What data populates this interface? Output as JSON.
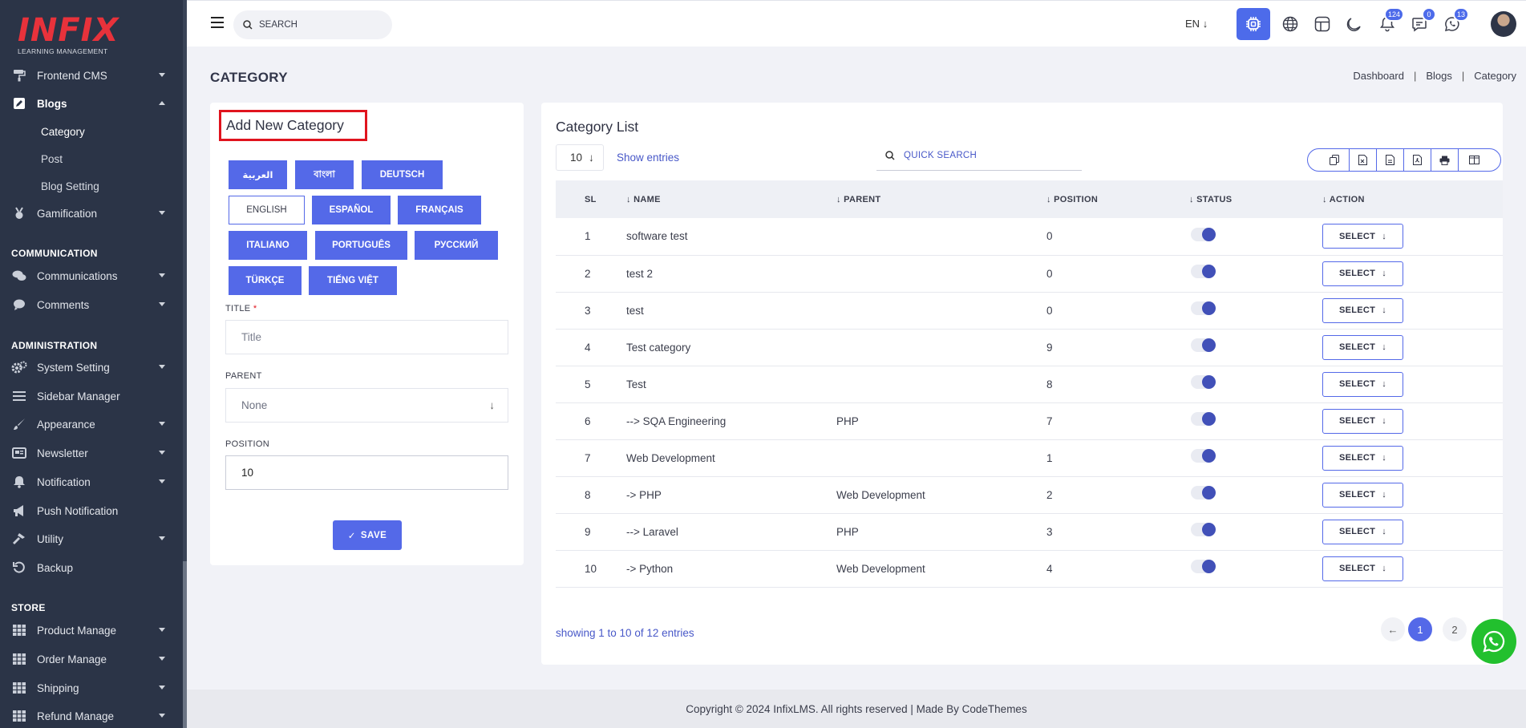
{
  "brand": {
    "name": "INFIX",
    "tagline": "LEARNING MANAGEMENT",
    "accent": "#e8323b",
    "primary": "#5469e8"
  },
  "sidebar": {
    "items": [
      {
        "label": "Frontend CMS",
        "icon": "paint-roller-icon"
      },
      {
        "label": "Blogs",
        "icon": "edit-icon"
      },
      {
        "label": "Gamification",
        "icon": "medal-icon"
      },
      {
        "label": "Communications",
        "icon": "chat-bubbles-icon"
      },
      {
        "label": "Comments",
        "icon": "comment-icon"
      },
      {
        "label": "System Setting",
        "icon": "gears-icon"
      },
      {
        "label": "Sidebar Manager",
        "icon": "bars-icon"
      },
      {
        "label": "Appearance",
        "icon": "brush-icon"
      },
      {
        "label": "Newsletter",
        "icon": "newsletter-icon"
      },
      {
        "label": "Notification",
        "icon": "bell-icon"
      },
      {
        "label": "Push Notification",
        "icon": "megaphone-icon"
      },
      {
        "label": "Utility",
        "icon": "hammer-icon"
      },
      {
        "label": "Backup",
        "icon": "backup-icon"
      },
      {
        "label": "Product Manage",
        "icon": "grid-icon"
      },
      {
        "label": "Order Manage",
        "icon": "grid-icon"
      },
      {
        "label": "Shipping",
        "icon": "grid-icon"
      },
      {
        "label": "Refund Manage",
        "icon": "grid-icon"
      }
    ],
    "blog_sub": [
      "Category",
      "Post",
      "Blog Setting"
    ],
    "sections": {
      "communication": "COMMUNICATION",
      "administration": "ADMINISTRATION",
      "store": "STORE"
    }
  },
  "topbar": {
    "search_placeholder": "SEARCH",
    "language": "EN",
    "badges": {
      "notifications": "124",
      "messages": "0",
      "whatsapp": "13"
    }
  },
  "page": {
    "title": "CATEGORY",
    "breadcrumb": [
      "Dashboard",
      "Blogs",
      "Category"
    ]
  },
  "form": {
    "title": "Add New Category",
    "languages": [
      "العربية",
      "বাংলা",
      "DEUTSCH",
      "ENGLISH",
      "ESPAÑOL",
      "FRANÇAIS",
      "ITALIANO",
      "PORTUGUÊS",
      "РУССКИЙ",
      "TÜRKÇE",
      "TIẾNG VIỆT"
    ],
    "active_language": "ENGLISH",
    "title_label": "TITLE",
    "title_required": "*",
    "title_placeholder": "Title",
    "parent_label": "PARENT",
    "parent_value": "None",
    "position_label": "POSITION",
    "position_value": "10",
    "save_label": "SAVE"
  },
  "list": {
    "title": "Category List",
    "entries_value": "10",
    "show_entries": "Show entries",
    "search_placeholder": "QUICK SEARCH",
    "columns": [
      "SL",
      "NAME",
      "PARENT",
      "POSITION",
      "STATUS",
      "ACTION"
    ],
    "rows": [
      {
        "sl": "1",
        "name": "software test",
        "parent": "",
        "position": "0",
        "status": true
      },
      {
        "sl": "2",
        "name": "test 2",
        "parent": "",
        "position": "0",
        "status": true
      },
      {
        "sl": "3",
        "name": "test",
        "parent": "",
        "position": "0",
        "status": true
      },
      {
        "sl": "4",
        "name": "Test category",
        "parent": "",
        "position": "9",
        "status": true
      },
      {
        "sl": "5",
        "name": "Test",
        "parent": "",
        "position": "8",
        "status": true
      },
      {
        "sl": "6",
        "name": "--> SQA Engineering",
        "parent": "PHP",
        "position": "7",
        "status": true
      },
      {
        "sl": "7",
        "name": "Web Development",
        "parent": "",
        "position": "1",
        "status": true
      },
      {
        "sl": "8",
        "name": "-> PHP",
        "parent": "Web Development",
        "position": "2",
        "status": true
      },
      {
        "sl": "9",
        "name": "--> Laravel",
        "parent": "PHP",
        "position": "3",
        "status": true
      },
      {
        "sl": "10",
        "name": "-> Python",
        "parent": "Web Development",
        "position": "4",
        "status": true
      }
    ],
    "action_label": "SELECT",
    "showing": "showing 1 to 10 of 12 entries",
    "pages": [
      "1",
      "2"
    ],
    "current_page": "1"
  },
  "footer": {
    "text": "Copyright © 2024 InfixLMS. All rights reserved | Made By CodeThemes"
  }
}
